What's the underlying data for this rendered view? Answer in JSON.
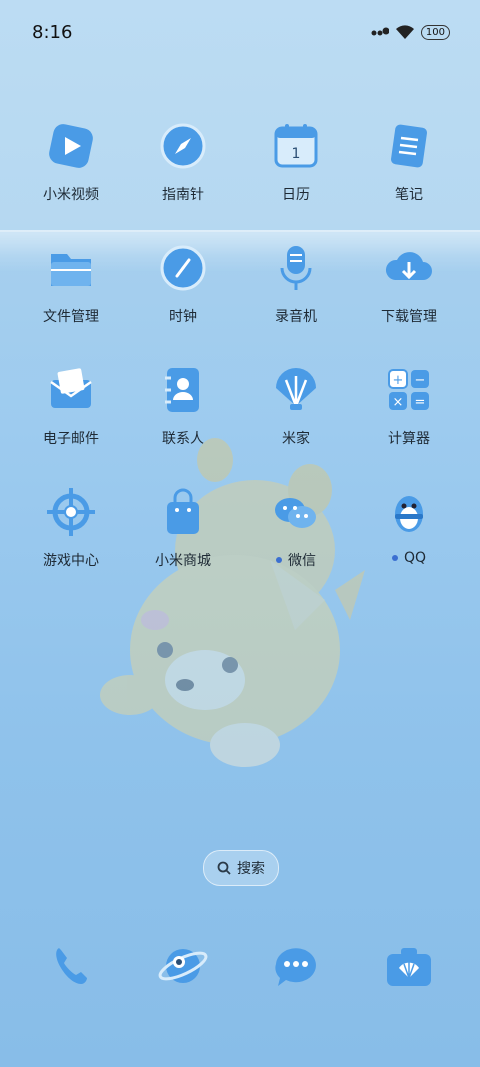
{
  "status": {
    "time": "8:16",
    "battery": "100"
  },
  "apps": [
    {
      "label": "小米视频",
      "icon": "video-icon",
      "dot": false
    },
    {
      "label": "指南针",
      "icon": "compass-icon",
      "dot": false
    },
    {
      "label": "日历",
      "icon": "calendar-icon",
      "dot": false,
      "calendar_day": "1"
    },
    {
      "label": "笔记",
      "icon": "notes-icon",
      "dot": false
    },
    {
      "label": "文件管理",
      "icon": "folder-icon",
      "dot": false
    },
    {
      "label": "时钟",
      "icon": "clock-icon",
      "dot": false
    },
    {
      "label": "录音机",
      "icon": "microphone-icon",
      "dot": false
    },
    {
      "label": "下载管理",
      "icon": "download-cloud-icon",
      "dot": false
    },
    {
      "label": "电子邮件",
      "icon": "mail-icon",
      "dot": false
    },
    {
      "label": "联系人",
      "icon": "contacts-icon",
      "dot": false
    },
    {
      "label": "米家",
      "icon": "shell-icon",
      "dot": false
    },
    {
      "label": "计算器",
      "icon": "calculator-icon",
      "dot": false
    },
    {
      "label": "游戏中心",
      "icon": "game-center-icon",
      "dot": false
    },
    {
      "label": "小米商城",
      "icon": "shopping-bag-icon",
      "dot": false
    },
    {
      "label": "微信",
      "icon": "wechat-icon",
      "dot": true
    },
    {
      "label": "QQ",
      "icon": "qq-penguin-icon",
      "dot": true
    }
  ],
  "search": {
    "label": "搜索"
  },
  "dock": [
    {
      "icon": "phone-icon"
    },
    {
      "icon": "browser-planet-icon"
    },
    {
      "icon": "messages-icon"
    },
    {
      "icon": "camera-icon"
    }
  ],
  "colors": {
    "icon_blue": "#4a9be6",
    "icon_light": "#ffffff",
    "dot": "#3b6fd1"
  }
}
